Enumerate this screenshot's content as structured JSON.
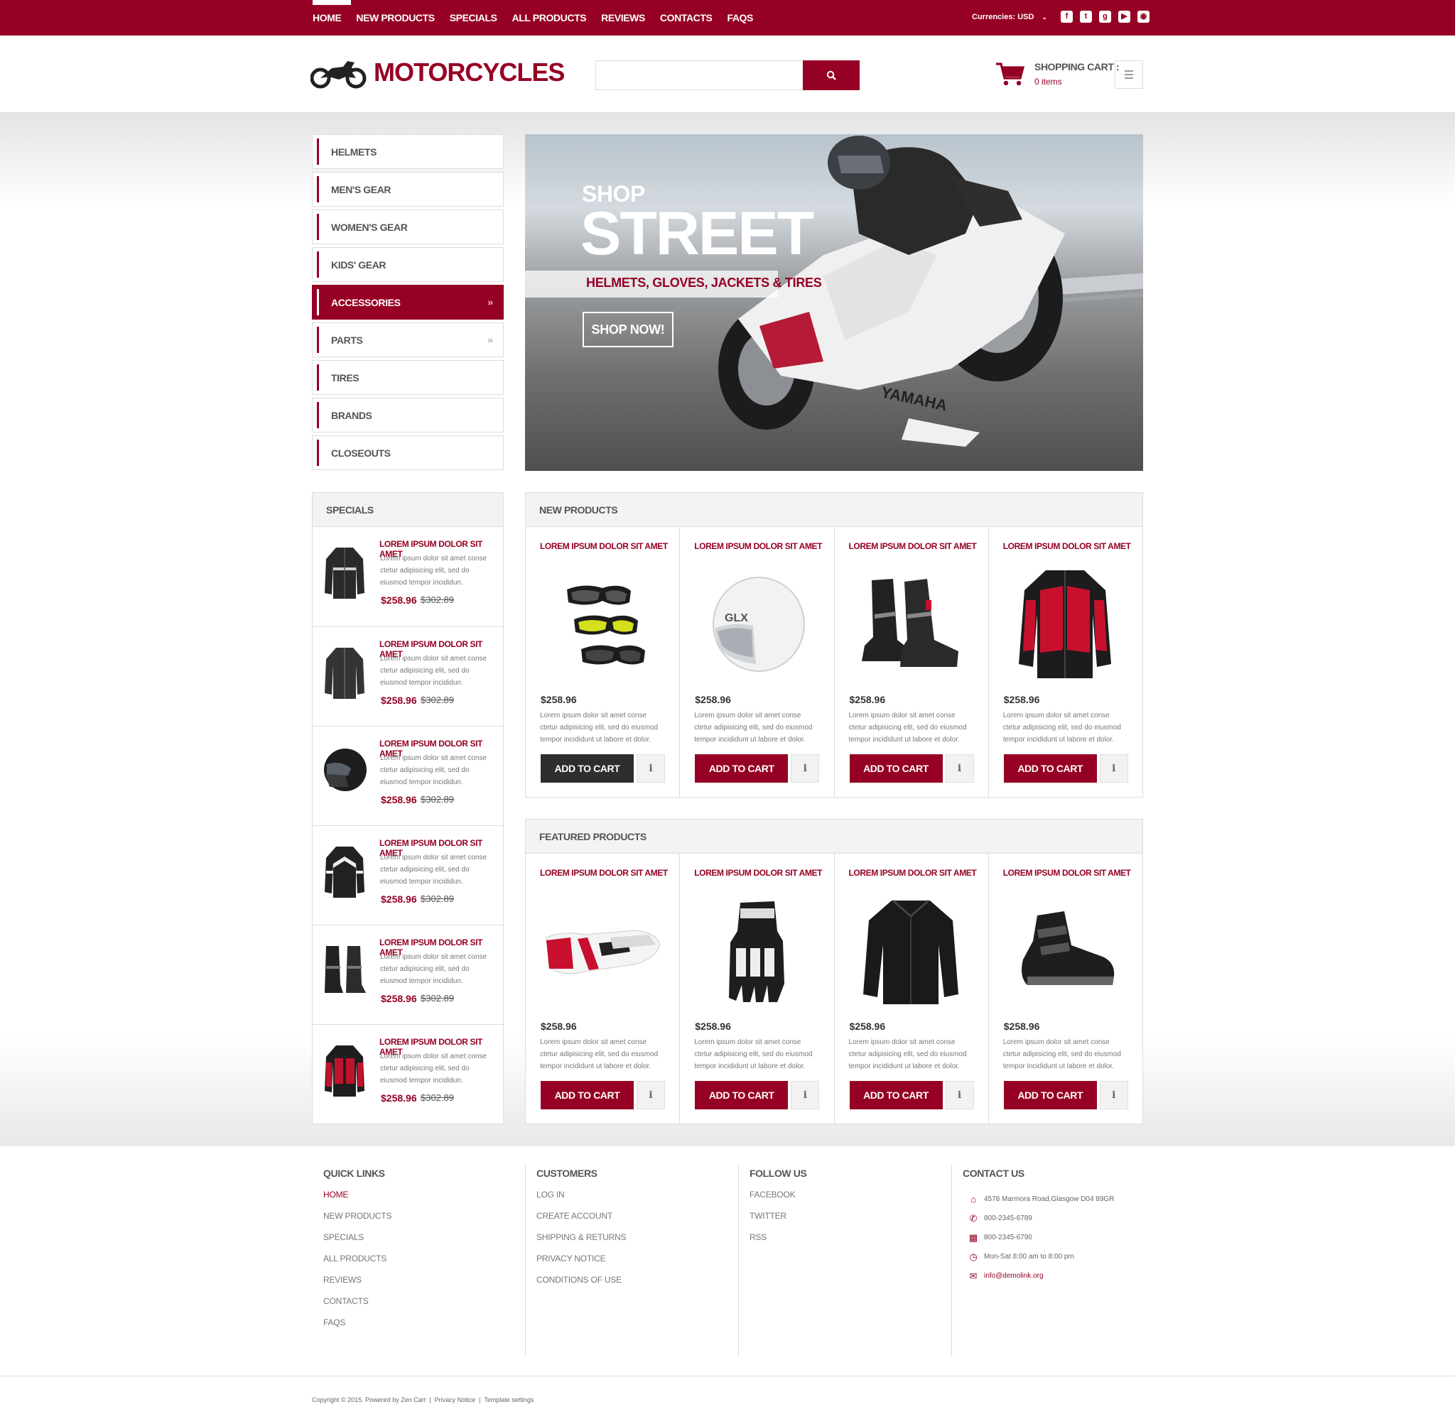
{
  "topnav": {
    "items": [
      "HOME",
      "NEW PRODUCTS",
      "SPECIALS",
      "ALL PRODUCTS",
      "REVIEWS",
      "CONTACTS",
      "FAQS"
    ],
    "currency_label": "Currencies:",
    "currency_value": "USD",
    "social_icons": [
      "facebook-icon",
      "twitter-icon",
      "google-plus-icon",
      "youtube-icon",
      "instagram-icon"
    ]
  },
  "header": {
    "logo_text": "MOTORCYCLES",
    "search_placeholder": "",
    "cart_title": "SHOPPING CART :",
    "cart_items": "0 items"
  },
  "categories": [
    {
      "label": "HELMETS",
      "active": false,
      "arrow": false
    },
    {
      "label": "MEN'S GEAR",
      "active": false,
      "arrow": false
    },
    {
      "label": "WOMEN'S GEAR",
      "active": false,
      "arrow": false
    },
    {
      "label": "KIDS' GEAR",
      "active": false,
      "arrow": false
    },
    {
      "label": "ACCESSORIES",
      "active": true,
      "arrow": true
    },
    {
      "label": "PARTS",
      "active": false,
      "arrow": true
    },
    {
      "label": "TIRES",
      "active": false,
      "arrow": false
    },
    {
      "label": "BRANDS",
      "active": false,
      "arrow": false
    },
    {
      "label": "CLOSEOUTS",
      "active": false,
      "arrow": false
    }
  ],
  "banner": {
    "line1": "SHOP",
    "line2": "STREET",
    "tagline": "HELMETS, GLOVES, JACKETS & TIRES",
    "button": "SHOP NOW!"
  },
  "specials": {
    "title": "SPECIALS",
    "items": [
      {
        "title": "LOREM IPSUM DOLOR SIT AMET",
        "desc": "Lorem ipsum dolor sit amet conse ctetur adipisicing elit, sed do eiusmod tempor incididun.",
        "price": "$258.96",
        "old_price": "$302.89",
        "image": "leather-jacket-image"
      },
      {
        "title": "LOREM IPSUM DOLOR SIT AMET",
        "desc": "Lorem ipsum dolor sit amet conse ctetur adipisicing elit, sed do eiusmod tempor incididun.",
        "price": "$258.96",
        "old_price": "$302.89",
        "image": "leather-jacket-image"
      },
      {
        "title": "LOREM IPSUM DOLOR SIT AMET",
        "desc": "Lorem ipsum dolor sit amet conse ctetur adipisicing elit, sed do eiusmod tempor incididun.",
        "price": "$258.96",
        "old_price": "$302.89",
        "image": "helmet-image"
      },
      {
        "title": "LOREM IPSUM DOLOR SIT AMET",
        "desc": "Lorem ipsum dolor sit amet conse ctetur adipisicing elit, sed do eiusmod tempor incididun.",
        "price": "$258.96",
        "old_price": "$302.89",
        "image": "jacket-image"
      },
      {
        "title": "LOREM IPSUM DOLOR SIT AMET",
        "desc": "Lorem ipsum dolor sit amet conse ctetur adipisicing elit, sed do eiusmod tempor incididun.",
        "price": "$258.96",
        "old_price": "$302.89",
        "image": "boots-image"
      },
      {
        "title": "LOREM IPSUM DOLOR SIT AMET",
        "desc": "Lorem ipsum dolor sit amet conse ctetur adipisicing elit, sed do eiusmod tempor incididun.",
        "price": "$258.96",
        "old_price": "$302.89",
        "image": "red-jacket-image"
      }
    ]
  },
  "new_products": {
    "title": "NEW PRODUCTS",
    "items": [
      {
        "title": "LOREM IPSUM DOLOR SIT AMET",
        "price": "$258.96",
        "desc": "Lorem ipsum dolor sit amet conse ctetur adipisicing elit, sed do eiusmod tempor incididunt ut labore et dolor.",
        "button": "ADD TO CART",
        "info": "i",
        "image": "goggles-image"
      },
      {
        "title": "LOREM IPSUM DOLOR SIT AMET",
        "price": "$258.96",
        "desc": "Lorem ipsum dolor sit amet conse ctetur adipisicing elit, sed do eiusmod tempor incididunt ut labore et dolor.",
        "button": "ADD TO CART",
        "info": "i",
        "image": "helmet-image"
      },
      {
        "title": "LOREM IPSUM DOLOR SIT AMET",
        "price": "$258.96",
        "desc": "Lorem ipsum dolor sit amet conse ctetur adipisicing elit, sed do eiusmod tempor incididunt ut labore et dolor.",
        "button": "ADD TO CART",
        "info": "i",
        "image": "boots-image"
      },
      {
        "title": "LOREM IPSUM DOLOR SIT AMET",
        "price": "$258.96",
        "desc": "Lorem ipsum dolor sit amet conse ctetur adipisicing elit, sed do eiusmod tempor incididunt ut labore et dolor.",
        "button": "ADD TO CART",
        "info": "i",
        "image": "red-jacket-image"
      }
    ]
  },
  "featured_products": {
    "title": "FEATURED PRODUCTS",
    "items": [
      {
        "title": "LOREM IPSUM DOLOR SIT AMET",
        "price": "$258.96",
        "desc": "Lorem ipsum dolor sit amet conse ctetur adipisicing elit, sed do eiusmod tempor incididunt ut labore et dolor.",
        "button": "ADD TO CART",
        "info": "i",
        "image": "glove-image"
      },
      {
        "title": "LOREM IPSUM DOLOR SIT AMET",
        "price": "$258.96",
        "desc": "Lorem ipsum dolor sit amet conse ctetur adipisicing elit, sed do eiusmod tempor incididunt ut labore et dolor.",
        "button": "ADD TO CART",
        "info": "i",
        "image": "glove-image"
      },
      {
        "title": "LOREM IPSUM DOLOR SIT AMET",
        "price": "$258.96",
        "desc": "Lorem ipsum dolor sit amet conse ctetur adipisicing elit, sed do eiusmod tempor incididunt ut labore et dolor.",
        "button": "ADD TO CART",
        "info": "i",
        "image": "jacket-image"
      },
      {
        "title": "LOREM IPSUM DOLOR SIT AMET",
        "price": "$258.96",
        "desc": "Lorem ipsum dolor sit amet conse ctetur adipisicing elit, sed do eiusmod tempor incididunt ut labore et dolor.",
        "button": "ADD TO CART",
        "info": "i",
        "image": "shoe-image"
      }
    ]
  },
  "footer": {
    "quick_links": {
      "title": "QUICK LINKS",
      "items": [
        "HOME",
        "NEW PRODUCTS",
        "SPECIALS",
        "ALL PRODUCTS",
        "REVIEWS",
        "CONTACTS",
        "FAQS"
      ]
    },
    "customers": {
      "title": "CUSTOMERS",
      "items": [
        "LOG IN",
        "CREATE ACCOUNT",
        "SHIPPING & RETURNS",
        "PRIVACY NOTICE",
        "CONDITIONS OF USE"
      ]
    },
    "follow_us": {
      "title": "FOLLOW US",
      "items": [
        "FACEBOOK",
        "TWITTER",
        "RSS"
      ]
    },
    "contact_us": {
      "title": "CONTACT US",
      "address": "4578 Marmora Road,Glasgow D04 89GR",
      "phone": "800-2345-6789",
      "fax": "800-2345-6790",
      "hours": "Mon-Sat 8:00 am to 8:00 pm",
      "email": "info@demolink.org"
    }
  },
  "copyright": {
    "text": "Copyright © 2015. Powered by Zen Cart",
    "privacy": "Privacy Notice",
    "settings": "Template settings"
  },
  "colors": {
    "brand": "#960024",
    "dark_button": "#2e2e2e"
  }
}
